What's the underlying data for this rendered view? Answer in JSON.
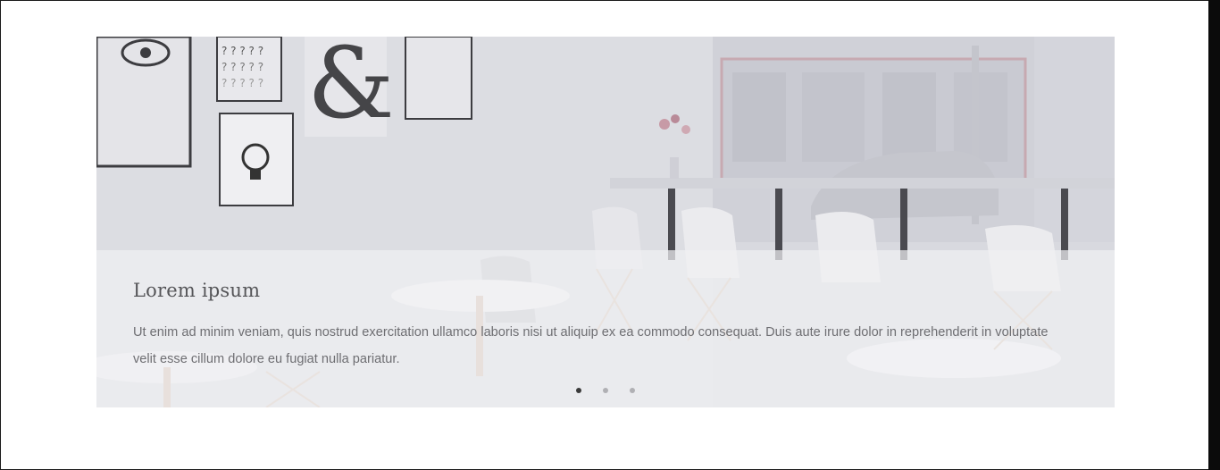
{
  "slider": {
    "image": "cafe-interior-photo",
    "caption": {
      "title": "Lorem ipsum",
      "text": "Ut enim ad minim veniam, quis nostrud exercitation ullamco laboris nisi ut aliquip ex ea commodo consequat. Duis aute irure dolor in reprehenderit in voluptate velit esse cillum dolore eu fugiat nulla pariatur."
    },
    "pagination": {
      "count": 3,
      "active_index": 0
    },
    "colors": {
      "active_dot": "#3a3a3a",
      "inactive_dot": "#b0b0b4",
      "caption_bg": "#f0f0f3"
    }
  }
}
